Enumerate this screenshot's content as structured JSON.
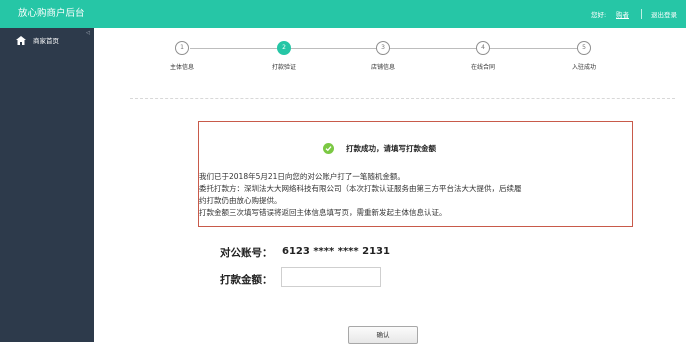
{
  "app": {
    "title": "放心购商户后台"
  },
  "sidebar": {
    "items": [
      {
        "label": "商家首页",
        "icon": "home-icon"
      }
    ],
    "collapse_icon": "◁"
  },
  "header": {
    "greeting": "您好:",
    "username": "购者",
    "logout": "退出登录"
  },
  "steps": [
    {
      "number": "1",
      "label": "主体信息",
      "active": false
    },
    {
      "number": "2",
      "label": "打款验证",
      "active": true
    },
    {
      "number": "3",
      "label": "店铺信息",
      "active": false
    },
    {
      "number": "4",
      "label": "在线合同",
      "active": false
    },
    {
      "number": "5",
      "label": "入驻成功",
      "active": false
    }
  ],
  "notice": {
    "success": "打款成功，请填写打款金额",
    "lines": [
      "我们已于2018年5月21日向您的对公账户打了一笔随机金额。",
      "委托打款方：深圳法大大网络科技有限公司（本次打款认证服务由第三方平台法大大提供，后续履",
      "约打款仍由放心购提供。",
      "打款金额三次填写错误将返回主体信息填写页，需重新发起主体信息认证。"
    ]
  },
  "form": {
    "account_label": "对公账号：",
    "account_value": "6123 **** **** 2131",
    "amount_label": "打款金额：",
    "amount_value": "",
    "amount_placeholder": ""
  },
  "actions": {
    "confirm": "确认"
  },
  "colors": {
    "accent": "#26c6a6",
    "sidebar": "#2d3a4b",
    "notice_border": "#c85a4a",
    "success": "#7bc843"
  }
}
